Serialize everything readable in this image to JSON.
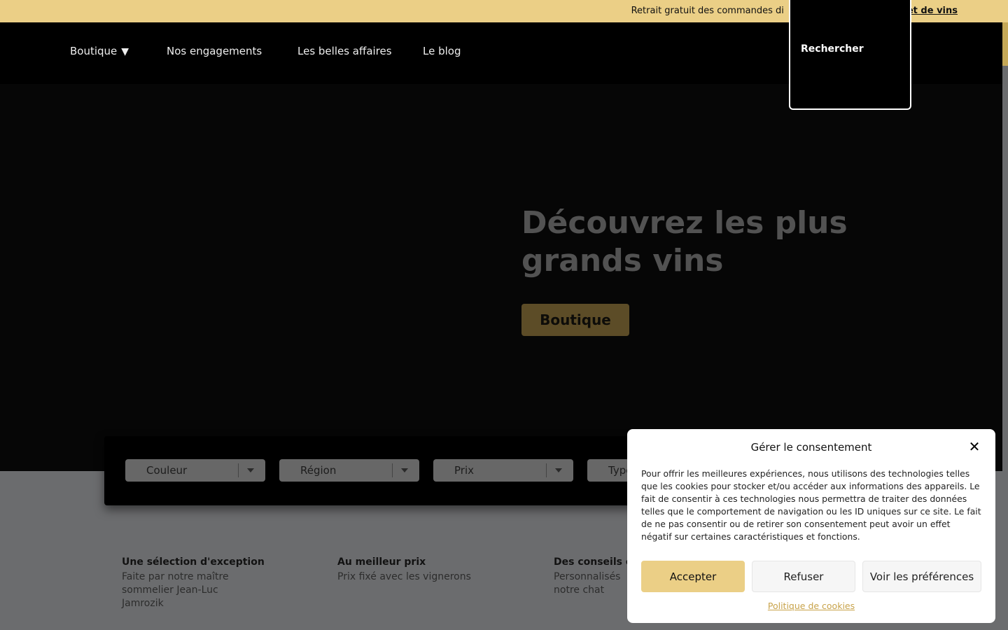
{
  "topbar": {
    "text": "Retrait gratuit des commandes di",
    "link": "et de vins"
  },
  "nav": {
    "items": [
      "Boutique",
      "Nos engagements",
      "Les belles affaires",
      "Le blog"
    ],
    "caret": "▼",
    "search_label": "Rechercher"
  },
  "hero": {
    "title": "Découvrez les plus grands vins",
    "button": "Boutique"
  },
  "filters": [
    "Couleur",
    "Région",
    "Prix",
    "Type"
  ],
  "features": [
    {
      "title": "Une sélection d'exception",
      "desc": "Faite par notre maître sommelier Jean-Luc Jamrozik"
    },
    {
      "title": "Au meilleur prix",
      "desc": "Prix fixé avec les vignerons"
    },
    {
      "title": "Des conseils e",
      "desc": "Personnalisés notre chat"
    }
  ],
  "cookie": {
    "title": "Gérer le consentement",
    "close": "✕",
    "text": "Pour offrir les meilleures expériences, nous utilisons des technologies telles que les cookies pour stocker et/ou accéder aux informations des appareils. Le fait de consentir à ces technologies nous permettra de traiter des données telles que le comportement de navigation ou les ID uniques sur ce site. Le fait de ne pas consentir ou de retirer son consentement peut avoir un effet négatif sur certaines caractéristiques et fonctions.",
    "accept": "Accepter",
    "refuse": "Refuser",
    "prefs": "Voir les préférences",
    "policy": "Politique de cookies"
  },
  "colors": {
    "accent": "#ebcf86",
    "hero_button": "#5c4c27"
  }
}
